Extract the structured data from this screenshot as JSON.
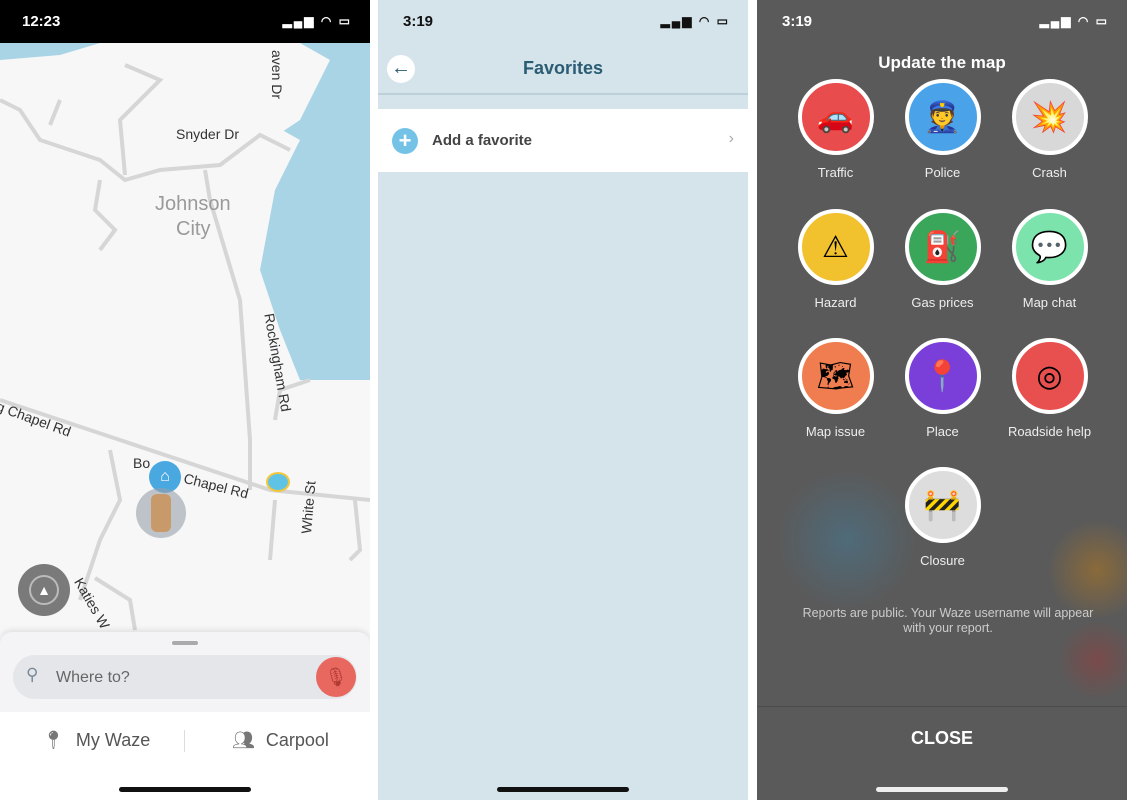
{
  "map_screen": {
    "status": {
      "time": "12:23"
    },
    "labels": {
      "snyder": "Snyder Dr",
      "haven": "aven Dr",
      "city1": "Johnson",
      "city2": "City",
      "rockingham": "Rockingham Rd",
      "chapel_left": "g Chapel Rd",
      "bo": "Bo",
      "chapel_right": "Chapel Rd",
      "white": "White St",
      "katies": "Katies W"
    },
    "search": {
      "placeholder": "Where to?"
    },
    "nav": {
      "my_waze": "My Waze",
      "carpool": "Carpool"
    },
    "colors": {
      "water": "#a8d4e6",
      "mic": "#e8675f"
    }
  },
  "favorites_screen": {
    "status": {
      "time": "3:19"
    },
    "title": "Favorites",
    "add_favorite": "Add a favorite",
    "colors": {
      "accent": "#52b7e0",
      "background": "#d5e3ea"
    }
  },
  "report_screen": {
    "status": {
      "time": "3:19"
    },
    "title": "Update the map",
    "options": [
      {
        "label": "Traffic",
        "icon": "traffic-icon",
        "color": "#e84c4c"
      },
      {
        "label": "Police",
        "icon": "police-icon",
        "color": "#4aa3e8"
      },
      {
        "label": "Crash",
        "icon": "crash-icon",
        "color": "#d8d8d8"
      },
      {
        "label": "Hazard",
        "icon": "hazard-icon",
        "color": "#f2c12e"
      },
      {
        "label": "Gas prices",
        "icon": "gas-pump-icon",
        "color": "#3aa65a"
      },
      {
        "label": "Map chat",
        "icon": "chat-bubble-icon",
        "color": "#7de3ad"
      },
      {
        "label": "Map issue",
        "icon": "map-issue-icon",
        "color": "#ef7d4f"
      },
      {
        "label": "Place",
        "icon": "place-pin-icon",
        "color": "#7a3fd8"
      },
      {
        "label": "Roadside help",
        "icon": "lifebuoy-icon",
        "color": "#e85050"
      },
      {
        "label": "Closure",
        "icon": "barrier-icon",
        "color": "#dddddd"
      }
    ],
    "disclaimer": "Reports are public. Your Waze username will appear with your report.",
    "close": "CLOSE"
  }
}
